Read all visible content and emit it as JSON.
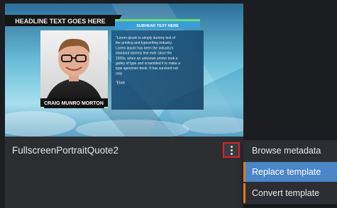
{
  "card": {
    "title": "FullscreenPortraitQuote2",
    "thumbnail": {
      "headline": "HEADLINE TEXT GOES HERE",
      "subhead": "SUBHEAD TEXT HERE",
      "name_caption": "CRAIG MUNRO MORTON",
      "quote_lines": [
        "\"Lorem ipsum is simply dummy text of",
        "the printing and typesetting industry.",
        "Lorem ipsum has been the industry's",
        "standard dummy text ever since the",
        "1500s, when an unknown printer took a",
        "galley of type and scrambled it to make a",
        "type specimen book. It has survived not",
        "only"
      ],
      "quote_attribution": "\"Ebdo"
    },
    "menu_icon": "kebab-vertical-icon"
  },
  "context_menu": {
    "items": [
      {
        "label": "Browse metadata",
        "state": "normal"
      },
      {
        "label": "Replace template",
        "state": "highlighted"
      },
      {
        "label": "Convert template",
        "state": "normal"
      }
    ]
  },
  "colors": {
    "highlight": "#4a86c8",
    "accent": "#e07b1a",
    "focus_outline": "#e0202a",
    "headline_bar": "#1a1a1a",
    "subhead_bar": "#3a9fd8"
  }
}
